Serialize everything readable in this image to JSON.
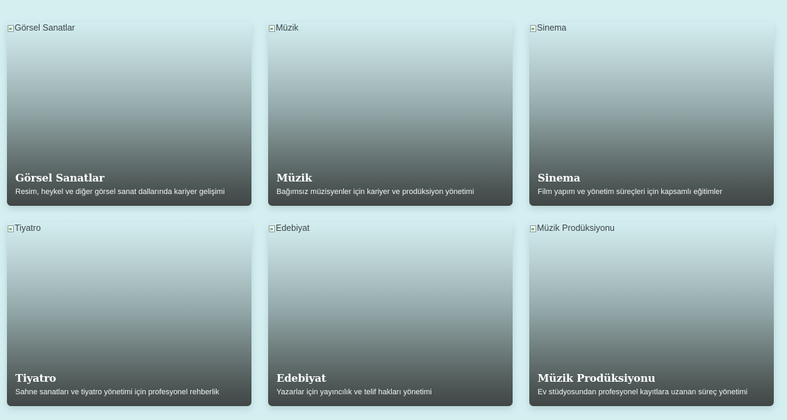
{
  "cards": [
    {
      "image_alt": "Görsel Sanatlar",
      "title": "Görsel Sanatlar",
      "description": "Resim, heykel ve diğer görsel sanat dallarında kariyer gelişimi"
    },
    {
      "image_alt": "Müzik",
      "title": "Müzik",
      "description": "Bağımsız müzisyenler için kariyer ve prodüksiyon yönetimi"
    },
    {
      "image_alt": "Sinema",
      "title": "Sinema",
      "description": "Film yapım ve yönetim süreçleri için kapsamlı eğitimler"
    },
    {
      "image_alt": "Tiyatro",
      "title": "Tiyatro",
      "description": "Sahne sanatları ve tiyatro yönetimi için profesyonel rehberlik"
    },
    {
      "image_alt": "Edebiyat",
      "title": "Edebiyat",
      "description": "Yazarlar için yayıncılık ve telif hakları yönetimi"
    },
    {
      "image_alt": "Müzik Prodüksiyonu",
      "title": "Müzik Prodüksiyonu",
      "description": "Ev stüdyosundan profesyonel kayıtlara uzanan süreç yönetimi"
    }
  ],
  "colors": {
    "page_background": "#d5eff1",
    "card_gradient_top": "#d3eef0",
    "card_gradient_bottom": "#414645",
    "title_text": "#ffffff",
    "description_text": "#eef3f3"
  },
  "icons": {
    "image_placeholder": "broken-image-icon"
  }
}
